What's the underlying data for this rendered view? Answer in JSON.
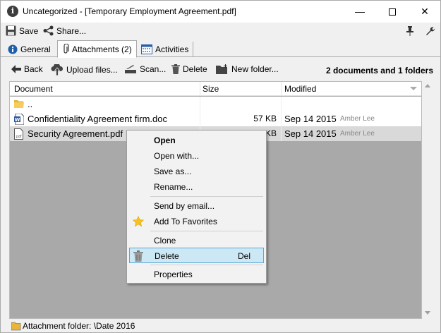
{
  "window": {
    "title": "Uncategorized - [Temporary Employment Agreement.pdf]",
    "minimize": "—",
    "close": "✕"
  },
  "commandbar": {
    "save_label": "Save",
    "share_label": "Share..."
  },
  "tabs": [
    {
      "label": "General"
    },
    {
      "label": "Attachments (2)"
    },
    {
      "label": "Activities"
    }
  ],
  "toolbar": {
    "back_label": "Back",
    "upload_label": "Upload files...",
    "scan_label": "Scan...",
    "delete_label": "Delete",
    "newfolder_label": "New folder...",
    "summary": "2 documents and 1 folders"
  },
  "list": {
    "columns": [
      "Document",
      "Size",
      "Modified"
    ],
    "rows": [
      {
        "name": "..",
        "size": "",
        "date": "",
        "author": "",
        "type": "folder"
      },
      {
        "name": "Confidentiality Agreement firm.doc",
        "size": "57 KB",
        "date": "Sep 14 2015",
        "author": "Amber Lee",
        "type": "word"
      },
      {
        "name": "Security Agreement.pdf",
        "size": "KB",
        "date": "Sep 14 2015",
        "author": "Amber Lee",
        "type": "pdf"
      }
    ]
  },
  "context_menu": {
    "open": "Open",
    "open_with": "Open with...",
    "save_as": "Save as...",
    "rename": "Rename...",
    "send_email": "Send by email...",
    "add_favorites": "Add To Favorites",
    "clone": "Clone",
    "delete": "Delete",
    "delete_shortcut": "Del",
    "properties": "Properties"
  },
  "status": {
    "text": "Attachment folder: \\Date 2016"
  },
  "colors": {
    "selection_row": "#d9d9d9",
    "menu_hover": "#cde8f5",
    "menu_hover_border": "#5aa6d6",
    "list_empty_area": "#a9a9a9"
  }
}
